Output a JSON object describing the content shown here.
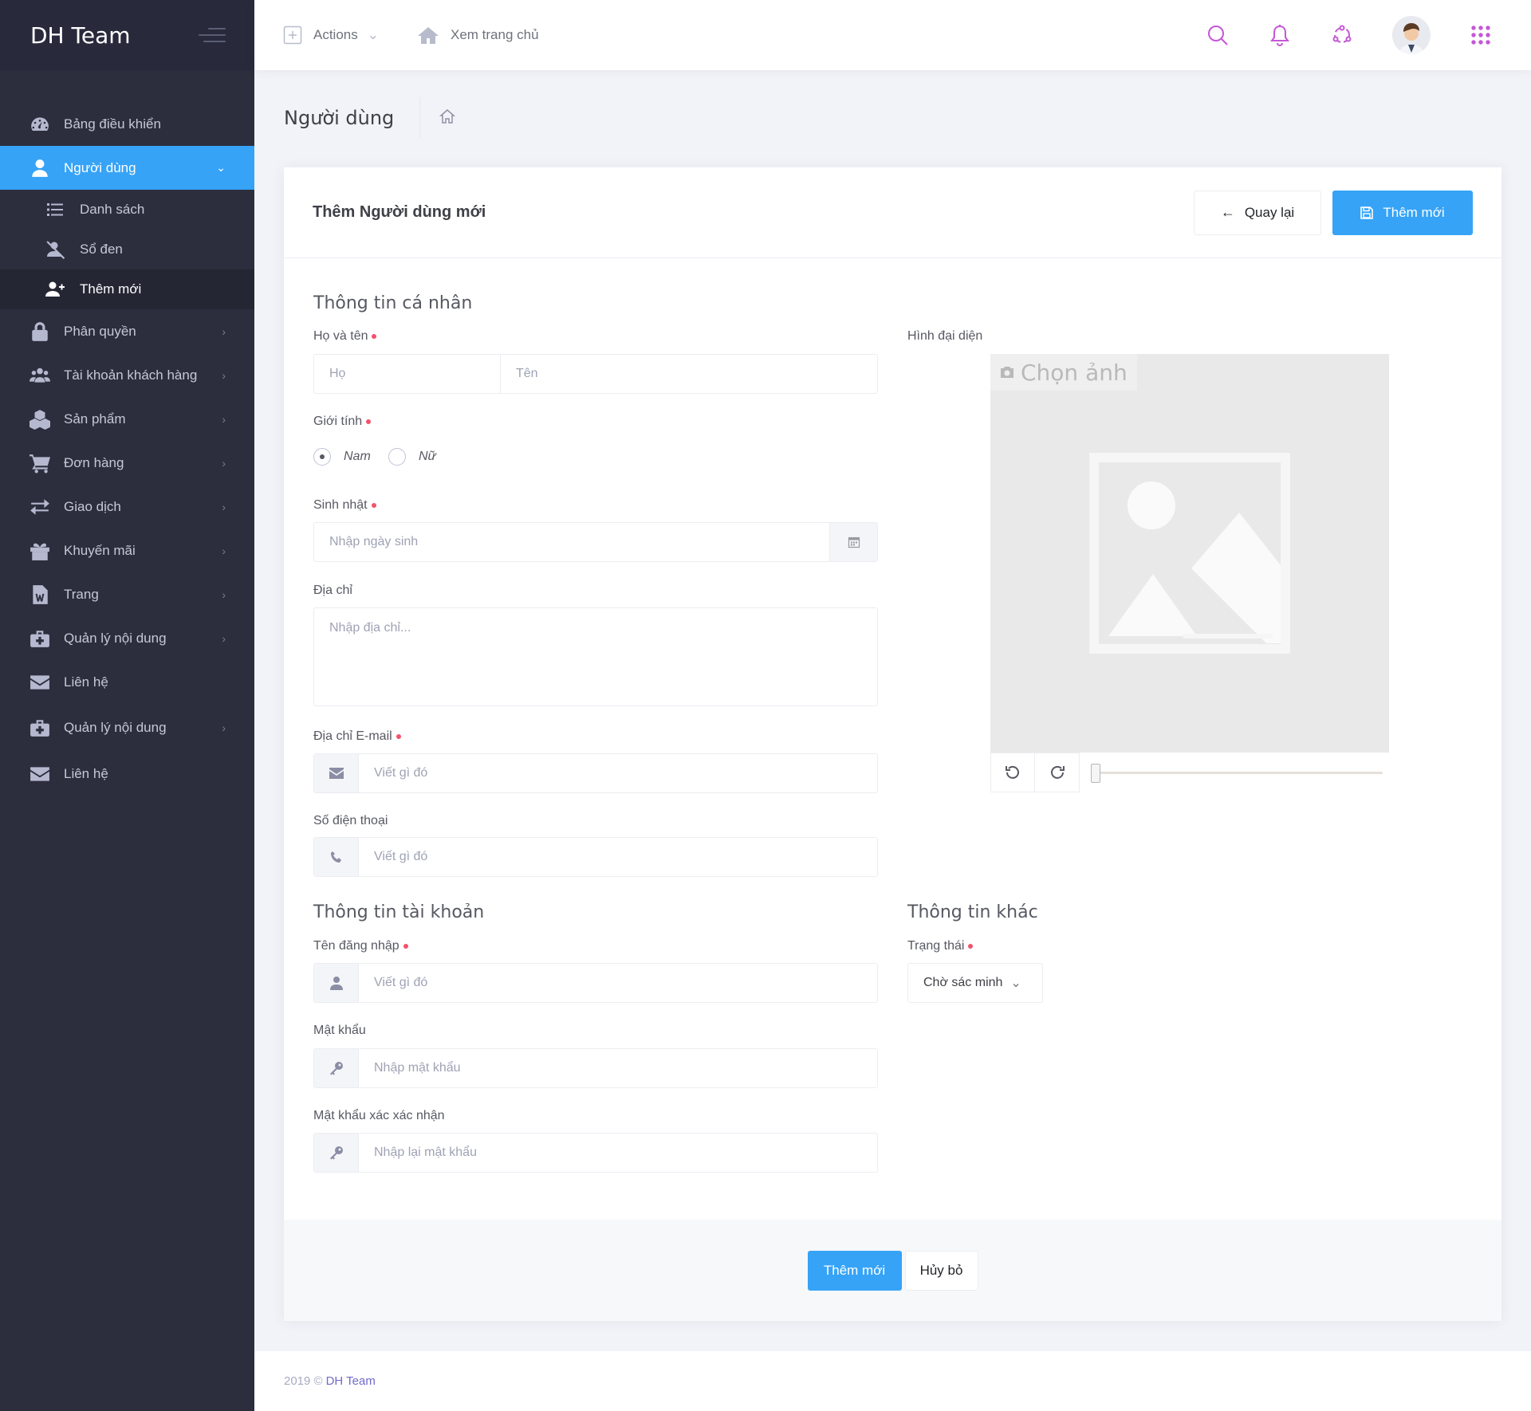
{
  "brand": "DH Team",
  "header": {
    "actions_label": "Actions",
    "home_label": "Xem trang chủ"
  },
  "sidebar": {
    "items": [
      {
        "label": "Bảng điều khiển",
        "icon": "dashboard-icon"
      },
      {
        "label": "Người dùng",
        "icon": "user-icon",
        "active": true
      },
      {
        "label": "Phân quyền",
        "icon": "lock-icon"
      },
      {
        "label": "Tài khoản khách hàng",
        "icon": "users-icon"
      },
      {
        "label": "Sản phẩm",
        "icon": "cubes-icon"
      },
      {
        "label": "Đơn hàng",
        "icon": "cart-icon"
      },
      {
        "label": "Giao dịch",
        "icon": "exchange-icon"
      },
      {
        "label": "Khuyến mãi",
        "icon": "gift-icon"
      },
      {
        "label": "Trang",
        "icon": "file-word-icon"
      },
      {
        "label": "Quản lý nội dung",
        "icon": "medkit-icon"
      },
      {
        "label": "Liên hệ",
        "icon": "envelope-icon"
      },
      {
        "label": "Quản lý nội dung",
        "icon": "medkit-icon"
      },
      {
        "label": "Liên hệ",
        "icon": "envelope-icon"
      }
    ],
    "sub_items": [
      {
        "label": "Danh sách",
        "icon": "list-icon"
      },
      {
        "label": "Sổ đen",
        "icon": "user-slash-icon"
      },
      {
        "label": "Thêm mới",
        "icon": "user-plus-icon",
        "current": true
      }
    ]
  },
  "page": {
    "title": "Người dùng"
  },
  "portlet": {
    "title": "Thêm Người dùng mới",
    "back_label": "Quay lại",
    "add_label": "Thêm mới"
  },
  "form": {
    "personal_title": "Thông tin cá nhân",
    "fullname_label": "Họ và tên",
    "lastname_placeholder": "Họ",
    "firstname_placeholder": "Tên",
    "gender_label": "Giới tính",
    "gender_male": "Nam",
    "gender_female": "Nữ",
    "birthday_label": "Sinh nhật",
    "birthday_placeholder": "Nhập ngày sinh",
    "address_label": "Địa chỉ",
    "address_placeholder": "Nhập địa chỉ...",
    "email_label": "Địa chỉ E-mail",
    "email_placeholder": "Viết gì đó",
    "phone_label": "Số điện thoại",
    "phone_placeholder": "Viết gì đó",
    "avatar_label": "Hình đại diện",
    "choose_image": "Chọn ảnh",
    "account_title": "Thông tin tài khoản",
    "username_label": "Tên đăng nhập",
    "username_placeholder": "Viết gì đó",
    "password_label": "Mật khẩu",
    "password_placeholder": "Nhập mật khẩu",
    "confirm_label": "Mật khẩu xác xác nhận",
    "confirm_placeholder": "Nhập lại mật khẩu",
    "other_title": "Thông tin khác",
    "status_label": "Trạng thái",
    "status_value": "Chờ sác minh",
    "submit_label": "Thêm mới",
    "cancel_label": "Hủy bỏ"
  },
  "footer": {
    "year": "2019 ©",
    "brand": "DH Team"
  },
  "colors": {
    "accent": "#36a3f7",
    "sidebar": "#2c2e3e",
    "required_dot": "#f4516c",
    "icon_accent": "#c458d6"
  }
}
